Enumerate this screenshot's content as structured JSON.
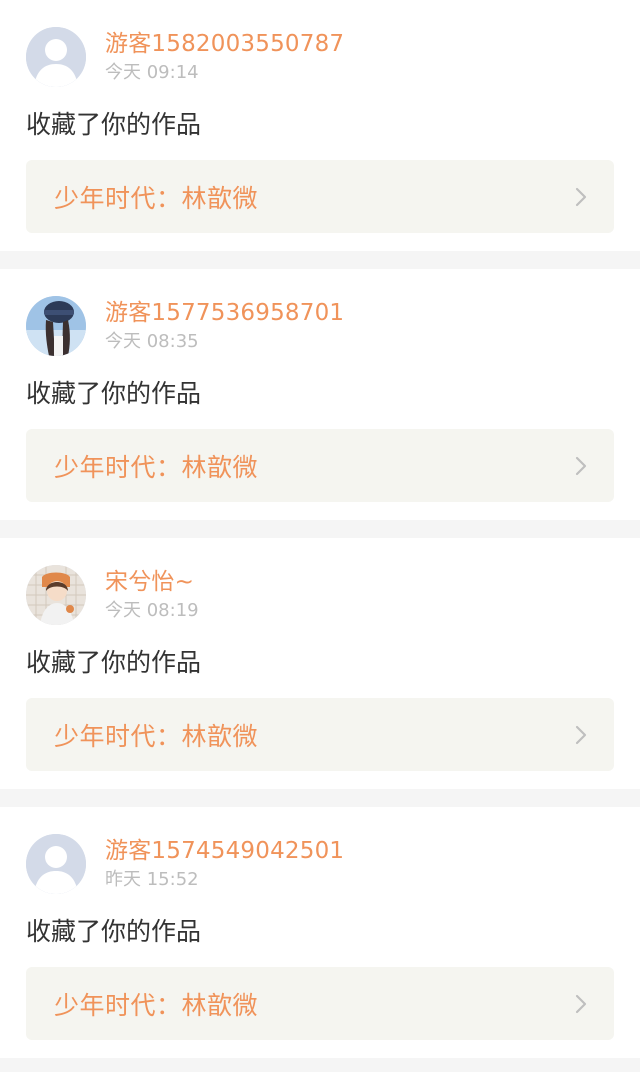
{
  "colors": {
    "accent": "#f0935a",
    "text": "#333333",
    "muted": "#bdbdbd",
    "card_link_bg": "#f5f5f0",
    "page_bg": "#f5f5f5"
  },
  "notifications": [
    {
      "username": "游客1582003550787",
      "time": "今天 09:14",
      "action": "收藏了你的作品",
      "work_title": "少年时代：林歆微",
      "avatar_icon": "default-user-icon"
    },
    {
      "username": "游客1577536958701",
      "time": "今天 08:35",
      "action": "收藏了你的作品",
      "work_title": "少年时代：林歆微",
      "avatar_icon": "user-photo"
    },
    {
      "username": "宋兮怡~",
      "time": "今天 08:19",
      "action": "收藏了你的作品",
      "work_title": "少年时代：林歆微",
      "avatar_icon": "user-photo"
    },
    {
      "username": "游客1574549042501",
      "time": "昨天 15:52",
      "action": "收藏了你的作品",
      "work_title": "少年时代：林歆微",
      "avatar_icon": "default-user-icon"
    }
  ]
}
